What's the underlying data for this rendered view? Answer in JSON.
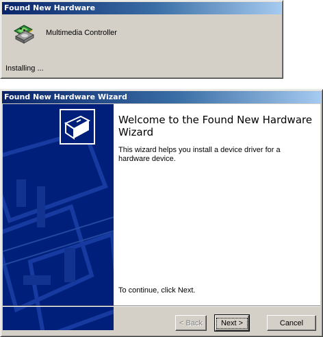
{
  "window_progress": {
    "title": "Found New Hardware",
    "device_name": "Multimedia Controller",
    "status": "Installing ..."
  },
  "window_wizard": {
    "title": "Found New Hardware Wizard",
    "heading": "Welcome to the Found New Hardware Wizard",
    "description": "This wizard helps you install a device driver for a hardware device.",
    "continue_text": "To continue, click Next.",
    "buttons": {
      "back": "< Back",
      "next": "Next >",
      "cancel": "Cancel"
    }
  },
  "icons": {
    "progress": "hardware-install-icon",
    "wizard": "hardware-card-icon"
  },
  "colors": {
    "title_active": "#0a246a",
    "title_gradient_end": "#a6caf0",
    "dialog_face": "#d4d0c8",
    "banner": "#001f7a"
  }
}
